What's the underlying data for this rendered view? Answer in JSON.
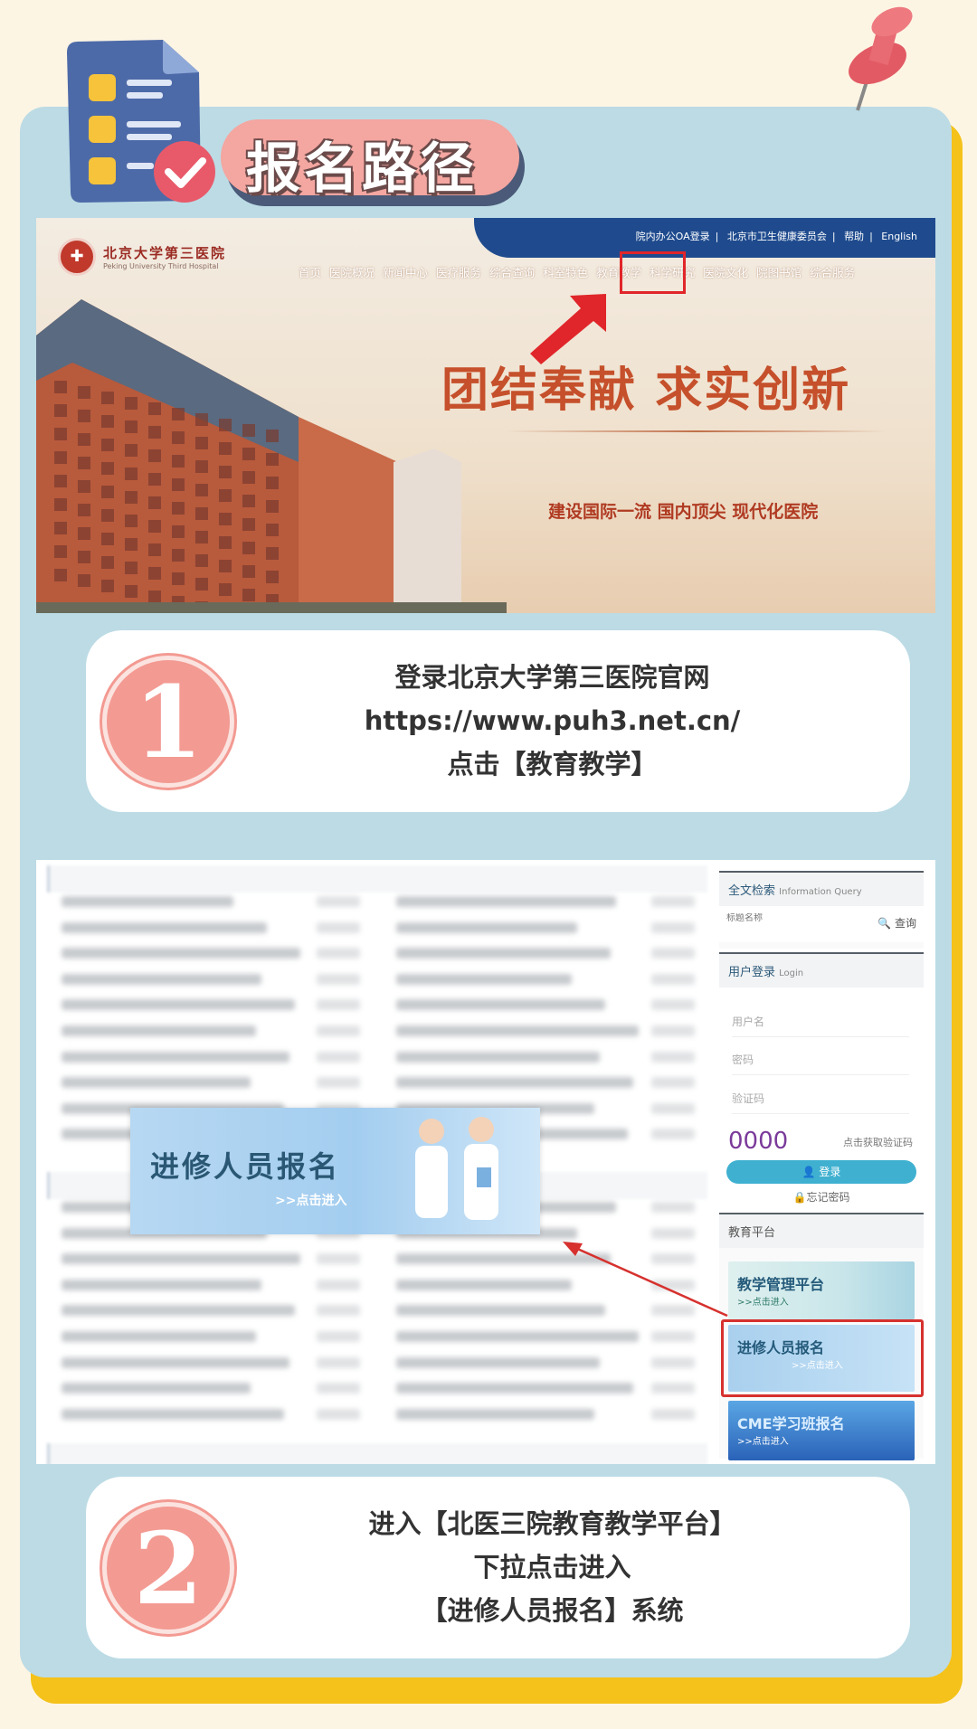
{
  "header": {
    "title": "报名路径",
    "icons": [
      "checklist-document-icon",
      "pushpin-icon",
      "checkmark-icon"
    ]
  },
  "colors": {
    "background": "#fdf5e4",
    "panel": "#bcdbe5",
    "shadow": "#f4c21a",
    "accent_pink": "#f39a92",
    "highlight_red": "#e0262a"
  },
  "site": {
    "top_links": [
      "院内办公OA登录",
      "北京市卫生健康委员会",
      "帮助",
      "English"
    ],
    "logo_cn": "北京大学第三医院",
    "logo_en": "Peking University Third Hospital",
    "nav": [
      "首页",
      "医院概况",
      "新闻中心",
      "医疗服务",
      "综合查询",
      "科室特色",
      "教育教学",
      "科学研究",
      "医院文化",
      "院图书馆",
      "综合服务"
    ],
    "slogan": "团结奉献  求实创新",
    "subslogan": "建设国际一流 国内顶尖 现代化医院"
  },
  "step1": {
    "number": "1",
    "line1": "登录北京大学第三医院官网",
    "url": "https://www.puh3.net.cn/",
    "line3": "点击【教育教学】"
  },
  "portal": {
    "search_title": "全文检索",
    "search_title_en": "Information Query",
    "search_placeholder": "标题名称",
    "search_button": "查询",
    "login_title": "用户登录",
    "login_title_en": "Login",
    "username": "用户名",
    "password": "密码",
    "code": "验证码",
    "captcha": "0000",
    "get_code": "点击获取验证码",
    "login_button": "登录",
    "forgot": "忘记密码",
    "platform_title": "教育平台",
    "banners": [
      {
        "title": "教学管理平台",
        "link": ">>点击进入"
      },
      {
        "title": "进修人员报名",
        "link": ">>点击进入"
      },
      {
        "title": "CME学习班报名",
        "link": ">>点击进入"
      }
    ],
    "overlay": {
      "title": "进修人员报名",
      "link": ">>点击进入"
    }
  },
  "step2": {
    "number": "2",
    "line1": "进入【北医三院教育教学平台】",
    "line2": "下拉点击进入",
    "line3": "【进修人员报名】系统"
  }
}
